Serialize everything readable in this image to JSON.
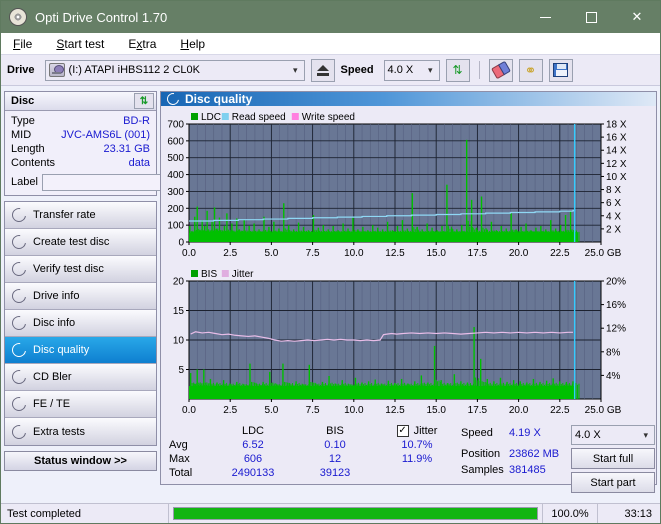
{
  "window": {
    "title": "Opti Drive Control 1.70",
    "icon": "disc-icon",
    "minimize": "minimize-icon",
    "maximize": "maximize-icon",
    "close": "close-icon"
  },
  "menu": [
    "File",
    "Start test",
    "Extra",
    "Help"
  ],
  "toolbar": {
    "drive_label": "Drive",
    "drive_value": "(I:)  ATAPI iHBS112  2 CL0K",
    "eject": "eject-icon",
    "speed_label": "Speed",
    "speed_value": "4.0 X",
    "refresh": "refresh-icon",
    "eraser": "eraser-icon",
    "tools": "tools-icon",
    "save": "save-icon"
  },
  "disc": {
    "header": "Disc",
    "refresh": "refresh-icon",
    "rows": [
      {
        "key": "Type",
        "value": "BD-R"
      },
      {
        "key": "MID",
        "value": "JVC-AMS6L (001)"
      },
      {
        "key": "Length",
        "value": "23.31 GB"
      },
      {
        "key": "Contents",
        "value": "data"
      }
    ],
    "label_key": "Label",
    "label_value": "",
    "label_button": "disc-icon"
  },
  "nav": {
    "items": [
      {
        "label": "Transfer rate",
        "selected": false
      },
      {
        "label": "Create test disc",
        "selected": false
      },
      {
        "label": "Verify test disc",
        "selected": false
      },
      {
        "label": "Drive info",
        "selected": false
      },
      {
        "label": "Disc info",
        "selected": false
      },
      {
        "label": "Disc quality",
        "selected": true
      },
      {
        "label": "CD Bler",
        "selected": false
      },
      {
        "label": "FE / TE",
        "selected": false
      },
      {
        "label": "Extra tests",
        "selected": false
      }
    ],
    "status_window": "Status window >>"
  },
  "main": {
    "title": "Disc quality",
    "icon": "disc-quality-icon"
  },
  "stats": {
    "columns": [
      "",
      "LDC",
      "BIS",
      "Jitter"
    ],
    "jitter_checked": true,
    "rows": [
      {
        "name": "Avg",
        "ldc": "6.52",
        "bis": "0.10",
        "jitter": "10.7%"
      },
      {
        "name": "Max",
        "ldc": "606",
        "bis": "12",
        "jitter": "11.9%"
      },
      {
        "name": "Total",
        "ldc": "2490133",
        "bis": "39123",
        "jitter": ""
      }
    ]
  },
  "readout": {
    "speed_key": "Speed",
    "speed_value": "4.19 X",
    "position_key": "Position",
    "position_value": "23862 MB",
    "samples_key": "Samples",
    "samples_value": "381485"
  },
  "controls": {
    "speed_select": "4.0 X",
    "start_full": "Start full",
    "start_part": "Start part"
  },
  "statusbar": {
    "message": "Test completed",
    "percent": "100.0%",
    "percent_value": 100,
    "elapsed": "33:13"
  },
  "chart_data": [
    {
      "type": "line",
      "name": "ldc-chart",
      "title": "Disc quality - LDC",
      "legend": [
        {
          "label": "LDC",
          "color": "#00a000"
        },
        {
          "label": "Read speed",
          "color": "#7fd0ef"
        },
        {
          "label": "Write speed",
          "color": "#ff7fe0"
        }
      ],
      "legend_position": "top-left",
      "xlabel": "GB",
      "ylabel": "LDC",
      "y2label": "Speed",
      "xlim": [
        0,
        25
      ],
      "ylim": [
        0,
        700
      ],
      "y2lim": [
        0,
        18
      ],
      "xticks": [
        "0.0",
        "2.5",
        "5.0",
        "7.5",
        "10.0",
        "12.5",
        "15.0",
        "17.5",
        "20.0",
        "22.5",
        "25.0 GB"
      ],
      "yticks": [
        0,
        100,
        200,
        300,
        400,
        500,
        600,
        700
      ],
      "y2ticks": [
        "2 X",
        "4 X",
        "6 X",
        "8 X",
        "10 X",
        "12 X",
        "14 X",
        "16 X",
        "18 X"
      ],
      "grid": true,
      "plot_bg": "#697795",
      "series": [
        {
          "name": "LDC",
          "color": "#00c000",
          "type": "spike",
          "x": [
            0.05,
            0.2,
            0.35,
            0.5,
            0.65,
            0.8,
            0.95,
            1.1,
            1.25,
            1.4,
            1.55,
            1.7,
            1.85,
            2.0,
            2.15,
            2.3,
            2.45,
            2.6,
            2.75,
            2.9,
            3.05,
            3.2,
            3.35,
            3.5,
            3.65,
            3.8,
            3.95,
            4.1,
            4.25,
            4.4,
            4.55,
            4.7,
            4.85,
            5.0,
            5.15,
            5.3,
            5.45,
            5.6,
            5.75,
            5.9,
            6.05,
            6.2,
            6.35,
            6.5,
            6.65,
            6.8,
            6.95,
            7.1,
            7.25,
            7.4,
            7.55,
            7.7,
            7.85,
            8.0,
            8.15,
            8.3,
            8.45,
            8.6,
            8.75,
            8.9,
            9.05,
            9.2,
            9.35,
            9.5,
            9.65,
            9.8,
            9.95,
            10.1,
            10.25,
            10.4,
            10.55,
            10.7,
            10.85,
            11.0,
            11.15,
            11.3,
            11.45,
            11.6,
            11.75,
            11.9,
            12.05,
            12.2,
            12.35,
            12.5,
            12.65,
            12.8,
            12.95,
            13.1,
            13.25,
            13.4,
            13.55,
            13.7,
            13.85,
            14.0,
            14.15,
            14.3,
            14.45,
            14.6,
            14.75,
            14.9,
            15.05,
            15.2,
            15.35,
            15.5,
            15.65,
            15.8,
            15.95,
            16.1,
            16.25,
            16.4,
            16.55,
            16.7,
            16.85,
            17.0,
            17.15,
            17.3,
            17.45,
            17.6,
            17.75,
            17.9,
            18.05,
            18.2,
            18.35,
            18.5,
            18.65,
            18.8,
            18.95,
            19.1,
            19.25,
            19.4,
            19.55,
            19.7,
            19.85,
            20.0,
            20.15,
            20.3,
            20.45,
            20.6,
            20.75,
            20.9,
            21.05,
            21.2,
            21.35,
            21.5,
            21.65,
            21.8,
            21.95,
            22.1,
            22.25,
            22.4,
            22.55,
            22.7,
            22.85,
            23.0,
            23.15,
            23.3
          ],
          "y": [
            95,
            60,
            150,
            210,
            70,
            130,
            95,
            185,
            60,
            120,
            205,
            80,
            145,
            60,
            95,
            170,
            55,
            110,
            60,
            140,
            75,
            60,
            130,
            55,
            95,
            60,
            110,
            55,
            75,
            60,
            150,
            60,
            90,
            55,
            120,
            60,
            80,
            55,
            230,
            60,
            100,
            55,
            75,
            60,
            115,
            55,
            90,
            60,
            70,
            55,
            160,
            60,
            85,
            55,
            100,
            60,
            75,
            55,
            95,
            60,
            70,
            55,
            110,
            60,
            80,
            55,
            145,
            60,
            75,
            55,
            90,
            60,
            70,
            55,
            100,
            60,
            85,
            55,
            75,
            60,
            120,
            55,
            70,
            60,
            95,
            55,
            130,
            60,
            80,
            55,
            290,
            60,
            90,
            55,
            75,
            60,
            110,
            55,
            85,
            60,
            70,
            55,
            95,
            60,
            340,
            55,
            80,
            60,
            75,
            55,
            100,
            60,
            606,
            55,
            250,
            60,
            85,
            55,
            270,
            60,
            75,
            55,
            120,
            60,
            70,
            55,
            95,
            60,
            80,
            55,
            170,
            60,
            75,
            55,
            90,
            60,
            110,
            55,
            70,
            60,
            85,
            55,
            95,
            60,
            75,
            55,
            130,
            60,
            80,
            55,
            100,
            60,
            160,
            55,
            180,
            60,
            150,
            120
          ]
        },
        {
          "name": "Read speed",
          "color": "#8fd8f5",
          "type": "step",
          "x": [
            0,
            1.5,
            3.0,
            4.5,
            6.0,
            7.5,
            9.0,
            10.5,
            12.0,
            13.5,
            15.0,
            16.5,
            18.0,
            19.5,
            21.0,
            22.5,
            23.3,
            23.4
          ],
          "y": [
            3.2,
            3.3,
            3.4,
            3.5,
            3.6,
            3.7,
            3.8,
            3.9,
            4.0,
            4.1,
            4.2,
            4.3,
            4.4,
            4.5,
            4.6,
            4.7,
            4.8,
            18.0
          ]
        }
      ]
    },
    {
      "type": "line",
      "name": "bis-jitter-chart",
      "title": "Disc quality - BIS / Jitter",
      "legend": [
        {
          "label": "BIS",
          "color": "#00a000"
        },
        {
          "label": "Jitter",
          "color": "#e0aee0"
        }
      ],
      "legend_position": "top-left",
      "xlabel": "GB",
      "ylabel": "BIS",
      "y2label": "Jitter",
      "xlim": [
        0,
        25
      ],
      "ylim": [
        0,
        20
      ],
      "y2lim": [
        0,
        20
      ],
      "xticks": [
        "0.0",
        "2.5",
        "5.0",
        "7.5",
        "10.0",
        "12.5",
        "15.0",
        "17.5",
        "20.0",
        "22.5",
        "25.0 GB"
      ],
      "yticks": [
        5,
        10,
        15,
        20
      ],
      "y2ticks": [
        "4%",
        "8%",
        "12%",
        "16%",
        "20%"
      ],
      "grid": true,
      "plot_bg": "#697795",
      "series": [
        {
          "name": "BIS",
          "color": "#00c000",
          "type": "spike",
          "x": [
            0.1,
            0.3,
            0.5,
            0.7,
            0.9,
            1.1,
            1.3,
            1.5,
            1.7,
            1.9,
            2.1,
            2.3,
            2.5,
            2.7,
            2.9,
            3.1,
            3.3,
            3.5,
            3.7,
            3.9,
            4.1,
            4.3,
            4.5,
            4.7,
            4.9,
            5.1,
            5.3,
            5.5,
            5.7,
            5.9,
            6.1,
            6.3,
            6.5,
            6.7,
            6.9,
            7.1,
            7.3,
            7.5,
            7.7,
            7.9,
            8.1,
            8.3,
            8.5,
            8.7,
            8.9,
            9.1,
            9.3,
            9.5,
            9.7,
            9.9,
            10.1,
            10.3,
            10.5,
            10.7,
            10.9,
            11.1,
            11.3,
            11.5,
            11.7,
            11.9,
            12.1,
            12.3,
            12.5,
            12.7,
            12.9,
            13.1,
            13.3,
            13.5,
            13.7,
            13.9,
            14.1,
            14.3,
            14.5,
            14.7,
            14.9,
            15.1,
            15.3,
            15.5,
            15.7,
            15.9,
            16.1,
            16.3,
            16.5,
            16.7,
            16.9,
            17.1,
            17.3,
            17.5,
            17.7,
            17.9,
            18.1,
            18.3,
            18.5,
            18.7,
            18.9,
            19.1,
            19.3,
            19.5,
            19.7,
            19.9,
            20.1,
            20.3,
            20.5,
            20.7,
            20.9,
            21.1,
            21.3,
            21.5,
            21.7,
            21.9,
            22.1,
            22.3,
            22.5,
            22.7,
            22.9,
            23.1,
            23.3
          ],
          "y": [
            4.4,
            2.6,
            5.0,
            2.4,
            5.0,
            2.3,
            3.4,
            2.2,
            2.8,
            2.3,
            3.2,
            2.2,
            2.6,
            2.3,
            2.9,
            2.2,
            2.5,
            2.3,
            6.0,
            2.2,
            2.6,
            2.3,
            2.9,
            2.2,
            4.6,
            2.3,
            2.5,
            2.2,
            6.0,
            2.3,
            2.7,
            2.2,
            3.0,
            2.3,
            2.5,
            2.2,
            5.8,
            2.3,
            2.6,
            2.2,
            2.9,
            2.3,
            3.9,
            2.2,
            2.6,
            2.3,
            3.2,
            2.2,
            2.5,
            2.3,
            3.6,
            2.2,
            2.8,
            2.3,
            3.0,
            2.2,
            3.3,
            2.3,
            2.6,
            2.2,
            3.1,
            2.3,
            2.7,
            2.2,
            3.4,
            2.3,
            2.6,
            2.2,
            3.0,
            2.3,
            4.0,
            2.2,
            2.8,
            2.3,
            9.0,
            2.2,
            3.2,
            2.3,
            2.7,
            2.2,
            4.2,
            2.3,
            3.0,
            2.2,
            2.8,
            2.3,
            12.2,
            2.2,
            6.8,
            2.3,
            3.4,
            2.2,
            3.0,
            2.3,
            3.6,
            2.2,
            2.9,
            2.3,
            3.2,
            2.2,
            3.0,
            2.3,
            2.8,
            2.2,
            3.4,
            2.3,
            2.9,
            2.2,
            3.1,
            2.3,
            3.5,
            2.2,
            3.0,
            2.3,
            2.9,
            2.2,
            3.0
          ]
        },
        {
          "name": "Jitter",
          "color": "#e8bde8",
          "type": "line",
          "x": [
            0.1,
            0.4,
            0.8,
            1.2,
            1.6,
            2.0,
            2.4,
            2.8,
            3.2,
            3.6,
            4.0,
            4.4,
            4.8,
            5.2,
            5.6,
            6.0,
            6.4,
            6.8,
            7.2,
            7.6,
            8.0,
            8.4,
            8.8,
            9.2,
            9.6,
            10.0,
            10.4,
            10.8,
            11.2,
            11.6,
            11.8,
            12.0,
            12.3,
            12.6,
            13.0,
            13.5,
            14.0,
            14.5,
            15.0,
            15.5,
            16.0,
            16.5,
            17.0,
            17.5,
            18.0,
            18.5,
            19.0,
            19.5,
            20.0,
            20.5,
            21.0,
            21.5,
            22.0,
            22.5,
            23.0,
            23.3
          ],
          "y": [
            11.0,
            11.4,
            11.2,
            11.3,
            11.1,
            10.9,
            11.0,
            10.8,
            10.7,
            10.6,
            10.7,
            10.5,
            10.3,
            10.0,
            9.8,
            9.9,
            9.8,
            9.9,
            10.0,
            9.9,
            10.0,
            10.1,
            10.0,
            10.1,
            10.0,
            10.0,
            9.9,
            10.0,
            9.9,
            10.0,
            10.9,
            11.0,
            11.1,
            11.0,
            11.1,
            11.2,
            11.1,
            11.2,
            11.1,
            11.2,
            11.1,
            11.0,
            11.1,
            11.2,
            11.3,
            11.2,
            11.3,
            11.2,
            11.3,
            11.2,
            11.3,
            11.2,
            11.3,
            11.2,
            11.3,
            11.3
          ]
        }
      ],
      "marker_line": {
        "x": 23.4,
        "color": "#33ccff"
      }
    }
  ]
}
